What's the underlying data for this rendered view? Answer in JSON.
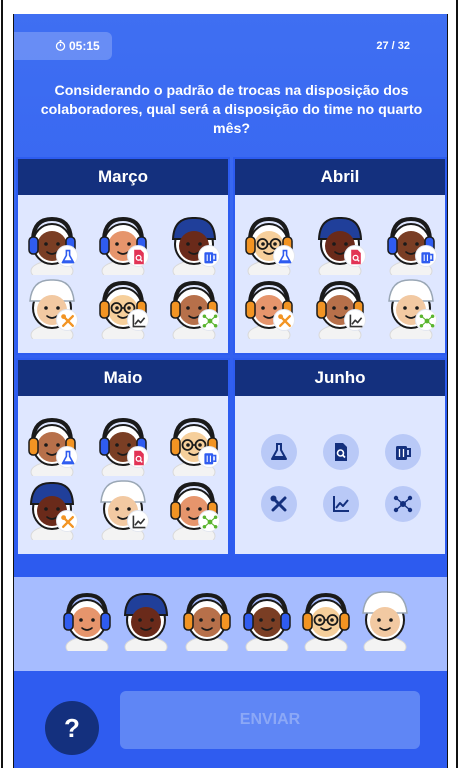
{
  "timer": {
    "text": "05:15",
    "icon": "stopwatch-icon"
  },
  "progress": {
    "text": "27 / 32"
  },
  "question": "Considerando o padrão de trocas na disposição dos colaboradores, qual será a disposição do time no quarto mês?",
  "months": [
    {
      "name": "Março",
      "people": [
        {
          "skin": "#7a3e24",
          "gear": "headphones",
          "gear_color": "#2f5cf0",
          "glasses": false,
          "role": "flask-icon"
        },
        {
          "skin": "#e6956c",
          "gear": "headphones",
          "gear_color": "#2f5cf0",
          "glasses": false,
          "role": "document-search-icon"
        },
        {
          "skin": "#6a2a1a",
          "gear": "cap",
          "gear_color": "#203f9a",
          "glasses": false,
          "role": "mug-icon"
        },
        {
          "skin": "#f2c9a2",
          "gear": "hardhat",
          "gear_color": "#ffffff",
          "glasses": false,
          "role": "tools-icon"
        },
        {
          "skin": "#f6cf9b",
          "gear": "headphones",
          "gear_color": "#f29423",
          "glasses": true,
          "role": "chart-line-icon"
        },
        {
          "skin": "#b7704a",
          "gear": "headphones",
          "gear_color": "#f29423",
          "glasses": false,
          "role": "network-icon"
        }
      ]
    },
    {
      "name": "Abril",
      "people": [
        {
          "skin": "#f6cf9b",
          "gear": "headphones",
          "gear_color": "#f29423",
          "glasses": true,
          "role": "flask-icon"
        },
        {
          "skin": "#6a2a1a",
          "gear": "cap",
          "gear_color": "#203f9a",
          "glasses": false,
          "role": "document-search-icon"
        },
        {
          "skin": "#7a3e24",
          "gear": "headphones",
          "gear_color": "#2f5cf0",
          "glasses": false,
          "role": "mug-icon"
        },
        {
          "skin": "#e6956c",
          "gear": "headphones",
          "gear_color": "#f29423",
          "glasses": false,
          "role": "tools-icon"
        },
        {
          "skin": "#b7704a",
          "gear": "headphones",
          "gear_color": "#f29423",
          "glasses": false,
          "role": "chart-line-icon"
        },
        {
          "skin": "#f2c9a2",
          "gear": "hardhat",
          "gear_color": "#ffffff",
          "glasses": false,
          "role": "network-icon"
        }
      ]
    },
    {
      "name": "Maio",
      "people": [
        {
          "skin": "#b7704a",
          "gear": "headphones",
          "gear_color": "#f29423",
          "glasses": false,
          "role": "flask-icon"
        },
        {
          "skin": "#7a3e24",
          "gear": "headphones",
          "gear_color": "#2f5cf0",
          "glasses": false,
          "role": "document-search-icon"
        },
        {
          "skin": "#f6cf9b",
          "gear": "headphones",
          "gear_color": "#f29423",
          "glasses": true,
          "role": "mug-icon"
        },
        {
          "skin": "#6a2a1a",
          "gear": "cap",
          "gear_color": "#203f9a",
          "glasses": false,
          "role": "tools-icon"
        },
        {
          "skin": "#f2c9a2",
          "gear": "hardhat",
          "gear_color": "#ffffff",
          "glasses": false,
          "role": "chart-line-icon"
        },
        {
          "skin": "#e6956c",
          "gear": "headphones",
          "gear_color": "#f29423",
          "glasses": false,
          "role": "network-icon"
        }
      ]
    },
    {
      "name": "Junho",
      "slots": [
        "flask-icon",
        "document-search-icon",
        "mug-icon",
        "tools-icon",
        "chart-line-icon",
        "network-icon"
      ]
    }
  ],
  "tray": [
    {
      "skin": "#e6956c",
      "gear": "headphones",
      "gear_color": "#2f5cf0",
      "glasses": false
    },
    {
      "skin": "#6a2a1a",
      "gear": "cap",
      "gear_color": "#203f9a",
      "glasses": false
    },
    {
      "skin": "#b7704a",
      "gear": "headphones",
      "gear_color": "#f29423",
      "glasses": false
    },
    {
      "skin": "#7a3e24",
      "gear": "headphones",
      "gear_color": "#2f5cf0",
      "glasses": false
    },
    {
      "skin": "#f6cf9b",
      "gear": "headphones",
      "gear_color": "#f29423",
      "glasses": true
    },
    {
      "skin": "#f2c9a2",
      "gear": "hardhat",
      "gear_color": "#ffffff",
      "glasses": false
    }
  ],
  "help": {
    "label": "?"
  },
  "send": {
    "label": "ENVIAR"
  },
  "colors": {
    "background": "#2f5cf0",
    "header": "#14307e",
    "panel": "#dfe7ff",
    "tray": "#a6bcff",
    "slot": "#b9c9f7"
  }
}
